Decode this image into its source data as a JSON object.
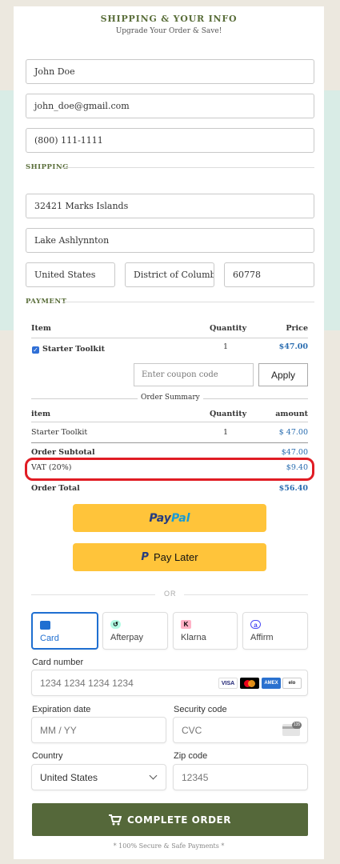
{
  "header": {
    "title": "SHIPPING & YOUR INFO",
    "subtitle": "Upgrade Your Order & Save!"
  },
  "contact": {
    "name": "John Doe",
    "email": "john_doe@gmail.com",
    "phone": "(800) 111-1111"
  },
  "shipping": {
    "label": "SHIPPING",
    "address": "32421 Marks Islands",
    "city": "Lake Ashlynnton",
    "country": "United States",
    "state": "District of Columbia",
    "zip": "60778"
  },
  "payment": {
    "label": "PAYMENT"
  },
  "order_table": {
    "headers": {
      "item": "Item",
      "quantity": "Quantity",
      "price": "Price"
    },
    "row": {
      "name": "Starter Toolkit",
      "quantity": "1",
      "price": "$47.00"
    },
    "coupon_placeholder": "Enter coupon code",
    "apply_label": "Apply"
  },
  "summary": {
    "title": "Order Summary",
    "headers": {
      "item": "item",
      "quantity": "Quantity",
      "amount": "amount"
    },
    "row": {
      "name": "Starter Toolkit",
      "quantity": "1",
      "amount": "$ 47.00"
    },
    "subtotal_label": "Order Subtotal",
    "subtotal": "$47.00",
    "vat_label": "VAT (20%)",
    "vat": "$9.40",
    "total_label": "Order Total",
    "total": "$56.40"
  },
  "paypal": {
    "brand_pay": "Pay",
    "brand_pal": "Pal",
    "pay_later_mark": "P",
    "pay_later_label": "Pay Later"
  },
  "or_label": "OR",
  "methods": [
    {
      "label": "Card",
      "icon": "card-icon"
    },
    {
      "label": "Afterpay",
      "icon": "afterpay-icon"
    },
    {
      "label": "Klarna",
      "icon": "klarna-icon"
    },
    {
      "label": "Affirm",
      "icon": "affirm-icon"
    }
  ],
  "card_form": {
    "card_number_label": "Card number",
    "card_number_placeholder": "1234 1234 1234 1234",
    "brands": [
      "VISA",
      "mastercard",
      "AMEX",
      "elo"
    ],
    "expiry_label": "Expiration date",
    "expiry_placeholder": "MM / YY",
    "cvc_label": "Security code",
    "cvc_placeholder": "CVC",
    "cvc_icon_text": "135",
    "country_label": "Country",
    "country_value": "United States",
    "zip_label": "Zip code",
    "zip_placeholder": "12345"
  },
  "complete_label": "COMPLETE ORDER",
  "secure_note": "* 100% Secure & Safe Payments *",
  "colors": {
    "olive": "#55683a",
    "accent_blue": "#2a6db0",
    "highlight_red": "#e01c24",
    "paypal_yellow": "#ffc43a"
  }
}
